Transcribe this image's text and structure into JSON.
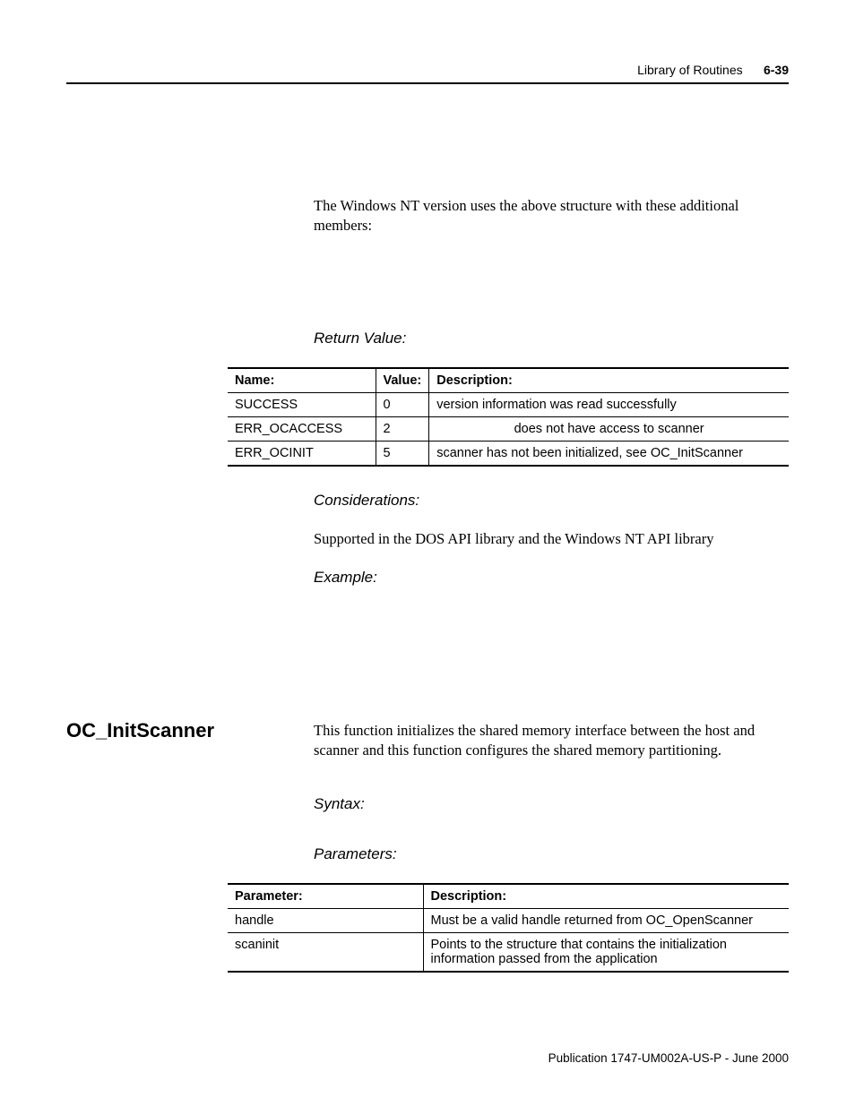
{
  "header": {
    "title": "Library of Routines",
    "page_ref": "6-39"
  },
  "intro_para": "The Windows NT version uses the above structure with these additional members:",
  "return_value": {
    "heading": "Return Value:",
    "columns": [
      "Name:",
      "Value:",
      "Description:"
    ],
    "rows": [
      {
        "name": "SUCCESS",
        "value": "0",
        "desc": "version information was read successfully"
      },
      {
        "name": "ERR_OCACCESS",
        "value": "2",
        "desc": "does not have access to scanner",
        "desc_centered": true
      },
      {
        "name": "ERR_OCINIT",
        "value": "5",
        "desc": "scanner has not been initialized, see OC_InitScanner"
      }
    ]
  },
  "considerations": {
    "heading": "Considerations:",
    "text": "Supported in the DOS API library and the Windows NT API library"
  },
  "example_heading": "Example:",
  "section": {
    "name": "OC_InitScanner",
    "desc": "This function initializes the shared memory interface between the host and scanner and this function configures the shared memory partitioning.",
    "syntax_heading": "Syntax:",
    "params_heading": "Parameters:",
    "params_columns": [
      "Parameter:",
      "Description:"
    ],
    "params_rows": [
      {
        "param": "handle",
        "desc": "Must be a valid handle returned from OC_OpenScanner"
      },
      {
        "param": "scaninit",
        "desc": "Points to the structure that contains the initialization information passed from the application"
      }
    ]
  },
  "footer": "Publication 1747-UM002A-US-P - June 2000"
}
